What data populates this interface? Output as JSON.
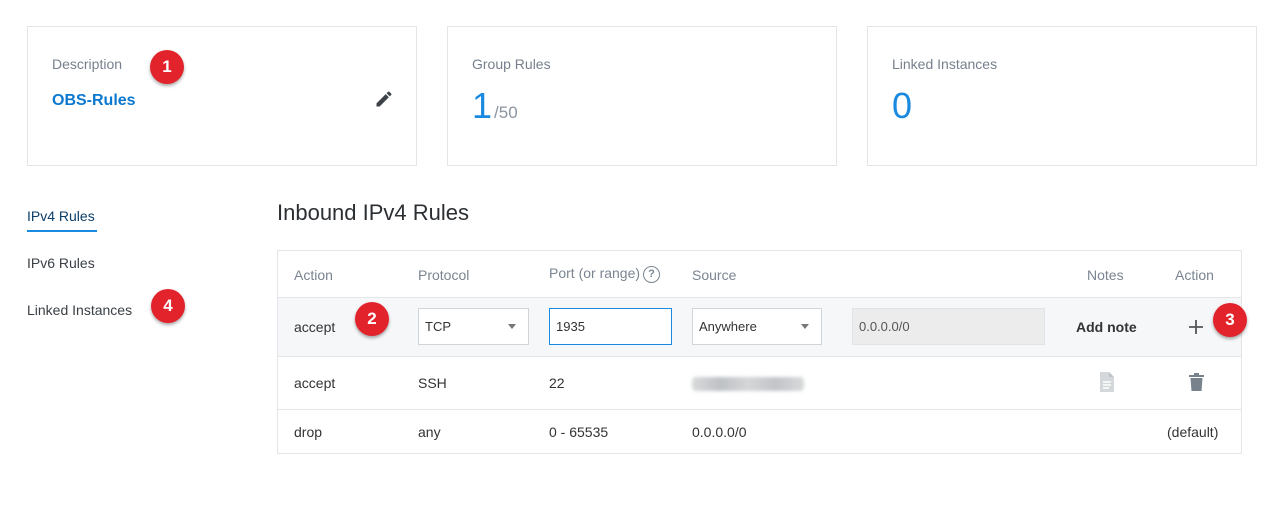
{
  "cards": {
    "description": {
      "label": "Description",
      "value": "OBS-Rules"
    },
    "group_rules": {
      "label": "Group Rules",
      "value": "1",
      "max": "/50"
    },
    "linked_instances": {
      "label": "Linked Instances",
      "value": "0"
    }
  },
  "badges": [
    "1",
    "2",
    "3",
    "4"
  ],
  "side_nav": {
    "items": [
      {
        "label": "IPv4 Rules",
        "active": true
      },
      {
        "label": "IPv6 Rules",
        "active": false
      },
      {
        "label": "Linked Instances",
        "active": false
      }
    ]
  },
  "section_title": "Inbound IPv4 Rules",
  "table": {
    "headers": {
      "action": "Action",
      "protocol": "Protocol",
      "port": "Port (or range)",
      "help": "?",
      "source": "Source",
      "notes": "Notes",
      "action2": "Action"
    },
    "edit_row": {
      "action": "accept",
      "protocol": "TCP",
      "port": "1935",
      "source_type": "Anywhere",
      "source_value": "0.0.0.0/0",
      "notes_button": "Add note",
      "add_icon": "plus-icon"
    },
    "rows": [
      {
        "action": "accept",
        "protocol": "SSH",
        "port": "22",
        "source": "",
        "notes_icon": "document-icon",
        "action_icon": "trash-icon"
      },
      {
        "action": "drop",
        "protocol": "any",
        "port": "0 - 65535",
        "source": "0.0.0.0/0",
        "action_text": "(default)"
      }
    ]
  },
  "colors": {
    "accent": "#1a8ae0",
    "link": "#0b78d0",
    "badge": "#e3232b"
  }
}
